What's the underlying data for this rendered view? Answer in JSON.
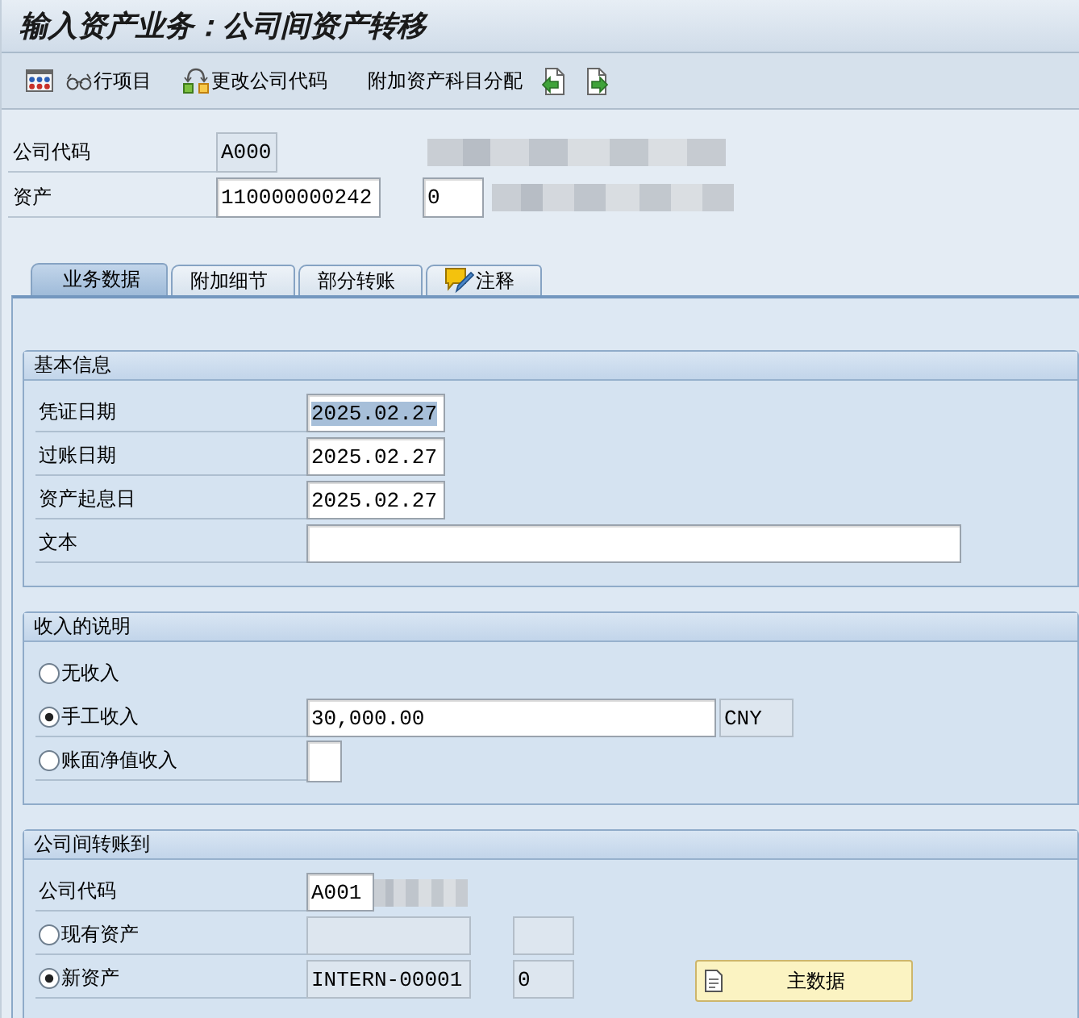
{
  "window": {
    "title": "输入资产业务：公司间资产转移"
  },
  "toolbar": [
    {
      "kind": "grid"
    },
    {
      "kind": "glasses",
      "label": "行项目"
    },
    {
      "kind": "swap",
      "label": "更改公司代码"
    },
    {
      "kind": "plain",
      "label": "附加资产科目分配"
    },
    {
      "kind": "back"
    },
    {
      "kind": "forward"
    }
  ],
  "header": [
    {
      "label": "公司代码",
      "blurred": true,
      "inputs": [
        {
          "kind": "code",
          "value": "A000",
          "readonly": true,
          "highlighted": false
        }
      ]
    },
    {
      "label": "资产",
      "blurred": true,
      "inputs": [
        {
          "kind": "asset",
          "value": "110000000242",
          "readonly": false,
          "highlighted": false
        },
        {
          "kind": "sub",
          "value": "0",
          "readonly": false,
          "highlighted": false
        }
      ]
    }
  ],
  "tabs": [
    {
      "label": "业务数据",
      "selected": true,
      "icon": false
    },
    {
      "label": "附加细节",
      "selected": false,
      "icon": false
    },
    {
      "label": "部分转账",
      "selected": false,
      "icon": false
    },
    {
      "label": "注释",
      "selected": false,
      "icon": true
    }
  ],
  "groups": [
    {
      "title": "基本信息",
      "rows": [
        {
          "kind": "field",
          "label": "凭证日期",
          "inputs": [
            {
              "kind": "date",
              "value": "2025.02.27",
              "readonly": false,
              "highlighted": true
            }
          ]
        },
        {
          "kind": "field",
          "label": "过账日期",
          "inputs": [
            {
              "kind": "date",
              "value": "2025.02.27",
              "readonly": false,
              "highlighted": false
            }
          ]
        },
        {
          "kind": "field",
          "label": "资产起息日",
          "inputs": [
            {
              "kind": "date",
              "value": "2025.02.27",
              "readonly": false,
              "highlighted": false
            }
          ]
        },
        {
          "kind": "field",
          "label": "文本",
          "inputs": [
            {
              "kind": "text",
              "readonly": false
            }
          ]
        }
      ]
    },
    {
      "title": "收入的说明",
      "rows": [
        {
          "kind": "radio",
          "label": "无收入",
          "selected": false
        },
        {
          "kind": "radio",
          "label": "手工收入",
          "selected": true,
          "inputs": [
            {
              "kind": "amount",
              "value": "30,000.00",
              "readonly": false,
              "highlighted": false
            },
            {
              "kind": "currency",
              "value": "CNY",
              "readonly": true,
              "highlighted": false
            }
          ]
        },
        {
          "kind": "radio",
          "label": "账面净值收入",
          "selected": false,
          "inputs": [
            {
              "kind": "flag",
              "readonly": false
            }
          ]
        }
      ]
    },
    {
      "title": "公司间转账到",
      "rows": [
        {
          "kind": "field",
          "label": "公司代码",
          "blurred": true,
          "inputs": [
            {
              "kind": "company",
              "value": "A001",
              "readonly": false,
              "highlighted": false
            }
          ]
        },
        {
          "kind": "radio",
          "label": "现有资产",
          "selected": false,
          "inputs": [
            {
              "kind": "asset",
              "readonly": true
            },
            {
              "kind": "sub",
              "readonly": true
            }
          ]
        },
        {
          "kind": "radio",
          "label": "新资产",
          "selected": true,
          "inputs": [
            {
              "kind": "asset",
              "value": "INTERN-00001",
              "readonly": true,
              "highlighted": false
            },
            {
              "kind": "sub",
              "value": "0",
              "readonly": true,
              "highlighted": false
            }
          ]
        }
      ]
    }
  ],
  "master_data_button": {
    "label": "主数据"
  }
}
